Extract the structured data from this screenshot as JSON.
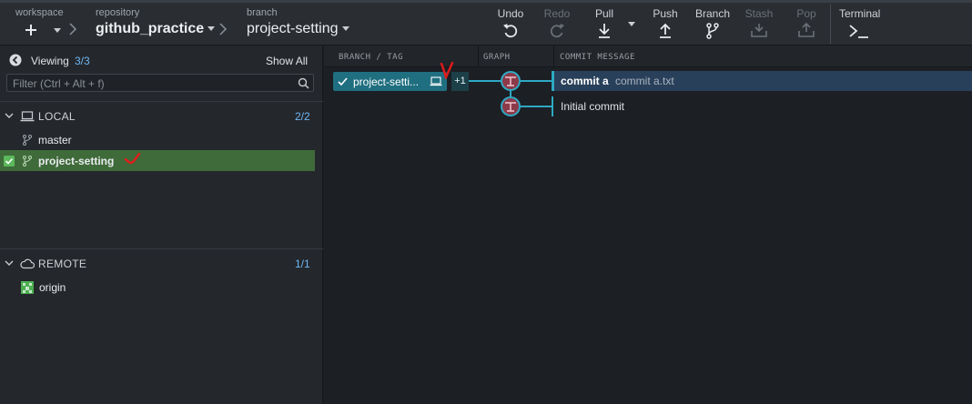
{
  "toolbar": {
    "workspace_caption": "workspace",
    "repository_caption": "repository",
    "repository_name": "github_practice",
    "branch_caption": "branch",
    "branch_name": "project-setting",
    "undo": "Undo",
    "redo": "Redo",
    "pull": "Pull",
    "push": "Push",
    "branch": "Branch",
    "stash": "Stash",
    "pop": "Pop",
    "terminal": "Terminal"
  },
  "left": {
    "viewing_label": "Viewing",
    "viewing_count": "3/3",
    "show_all": "Show All",
    "filter_placeholder": "Filter (Ctrl + Alt + f)",
    "local": {
      "title": "LOCAL",
      "count": "2/2",
      "branches": [
        {
          "name": "master",
          "checked_out": false
        },
        {
          "name": "project-setting",
          "checked_out": true
        }
      ]
    },
    "remote": {
      "title": "REMOTE",
      "count": "1/1",
      "items": [
        {
          "name": "origin"
        }
      ]
    }
  },
  "graph": {
    "columns": {
      "branch_tag": "BRANCH / TAG",
      "graph": "GRAPH",
      "commit_message": "COMMIT MESSAGE"
    },
    "branch_label": "project-setti...",
    "extra_count": "+1",
    "commits": [
      {
        "summary": "commit a",
        "files": "commit a.txt"
      },
      {
        "summary": "Initial commit",
        "files": ""
      }
    ]
  },
  "colors": {
    "accent": "#2ea9c4",
    "checked_branch_bg": "#3f6b3a",
    "selected_row": "#29405a",
    "annotation": "#e01b1b"
  }
}
